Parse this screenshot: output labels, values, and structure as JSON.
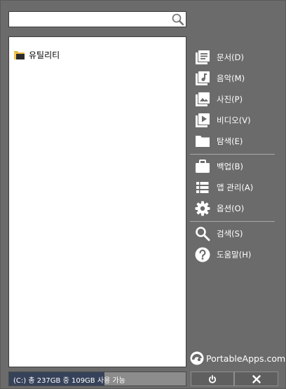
{
  "search": {
    "value": "",
    "placeholder": ""
  },
  "app_list": {
    "items": [
      {
        "label": "유틸리티",
        "icon": "folder-icon"
      }
    ]
  },
  "menu": {
    "items": [
      {
        "label": "문서(D)",
        "icon": "documents-icon"
      },
      {
        "label": "음악(M)",
        "icon": "music-icon"
      },
      {
        "label": "사진(P)",
        "icon": "pictures-icon"
      },
      {
        "label": "비디오(V)",
        "icon": "video-icon"
      },
      {
        "label": "탐색(E)",
        "icon": "folder-icon"
      },
      {
        "label": "백업(B)",
        "icon": "briefcase-icon"
      },
      {
        "label": "앱 관리(A)",
        "icon": "list-icon"
      },
      {
        "label": "옵션(O)",
        "icon": "gear-icon"
      },
      {
        "label": "검색(S)",
        "icon": "search-icon"
      },
      {
        "label": "도움말(H)",
        "icon": "help-icon"
      }
    ]
  },
  "brand": {
    "text": "PortableApps.com"
  },
  "status": {
    "text": "(C:) 총 237GB 중 109GB 사용 가능",
    "used_fraction": 0.54
  },
  "colors": {
    "background": "#6b6b6b",
    "status_fill": "#36425a",
    "text": "#ffffff"
  }
}
